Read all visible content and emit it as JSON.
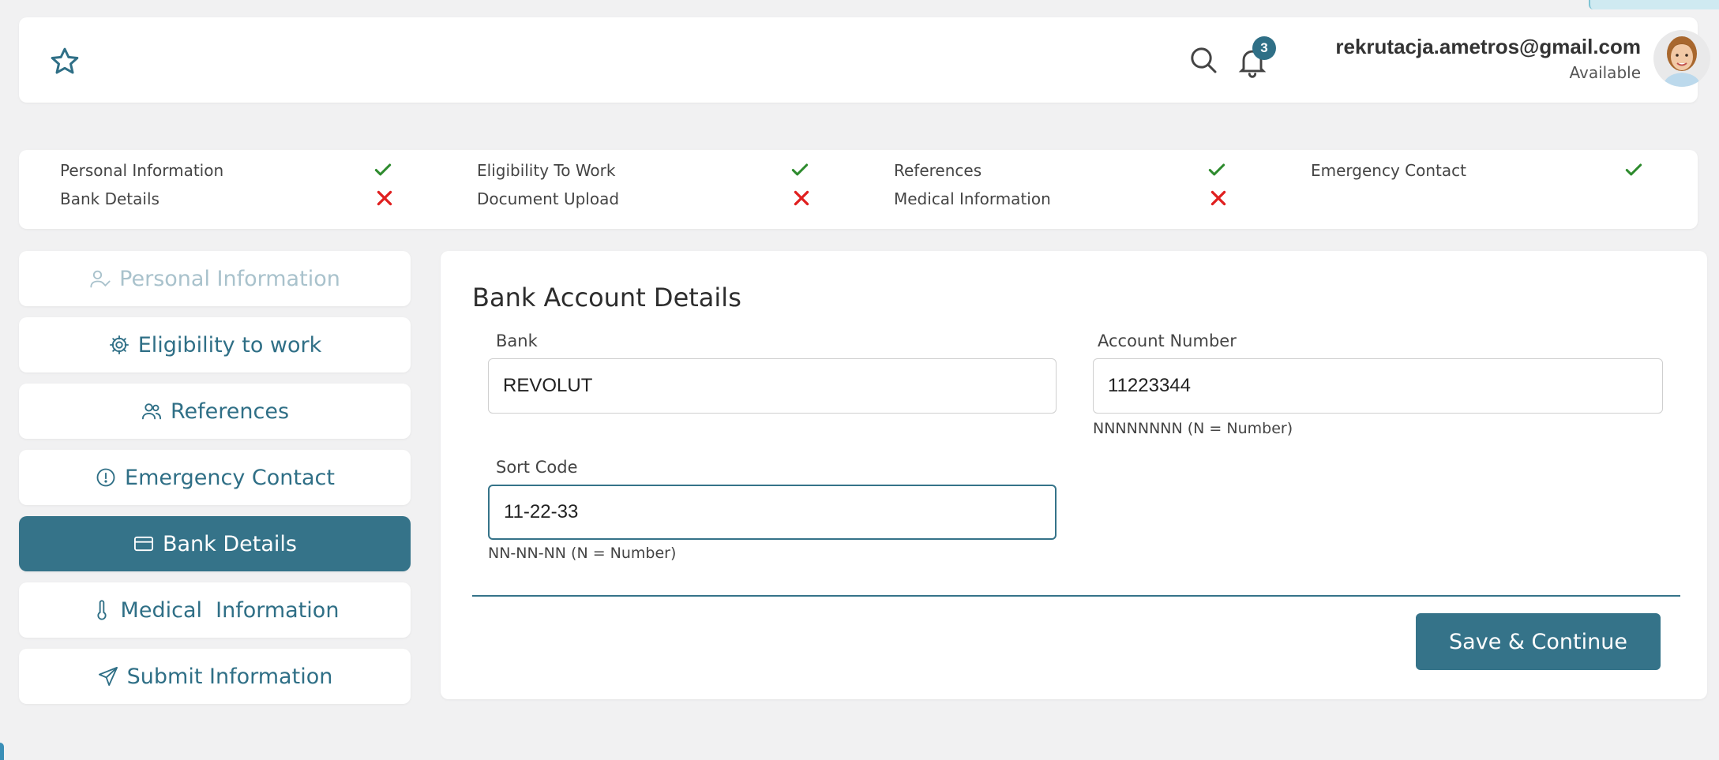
{
  "header": {
    "notification_count": "3",
    "user_email": "rekrutacja.ametros@gmail.com",
    "user_status": "Available"
  },
  "progress": {
    "steps": [
      {
        "label": "Personal Information",
        "status": "complete"
      },
      {
        "label": "Eligibility To Work",
        "status": "complete"
      },
      {
        "label": "References",
        "status": "complete"
      },
      {
        "label": "Emergency Contact",
        "status": "complete"
      },
      {
        "label": "Bank Details",
        "status": "incomplete"
      },
      {
        "label": "Document Upload",
        "status": "incomplete"
      },
      {
        "label": "Medical Information",
        "status": "incomplete"
      }
    ]
  },
  "sidebar": {
    "items": [
      {
        "label": "Personal Information",
        "icon": "user-check-icon",
        "state": "disabled"
      },
      {
        "label": "Eligibility to work",
        "icon": "gear-icon",
        "state": "normal"
      },
      {
        "label": "References",
        "icon": "users-icon",
        "state": "normal"
      },
      {
        "label": "Emergency Contact",
        "icon": "alert-circle-icon",
        "state": "normal"
      },
      {
        "label": "Bank Details",
        "icon": "credit-card-icon",
        "state": "active"
      },
      {
        "label": "Medical  Information",
        "icon": "thermometer-icon",
        "state": "normal"
      },
      {
        "label": "Submit Information",
        "icon": "send-icon",
        "state": "normal"
      }
    ]
  },
  "form": {
    "title": "Bank Account Details",
    "bank": {
      "label": "Bank",
      "value": "REVOLUT"
    },
    "account_number": {
      "label": "Account Number",
      "value": "11223344",
      "hint": "NNNNNNNN (N = Number)"
    },
    "sort_code": {
      "label": "Sort Code",
      "value": "11-22-33",
      "hint": "NN-NN-NN (N = Number)"
    },
    "save_label": "Save & Continue"
  },
  "colors": {
    "accent": "#357389",
    "check": "#2e8b2e",
    "cross": "#e02020"
  }
}
